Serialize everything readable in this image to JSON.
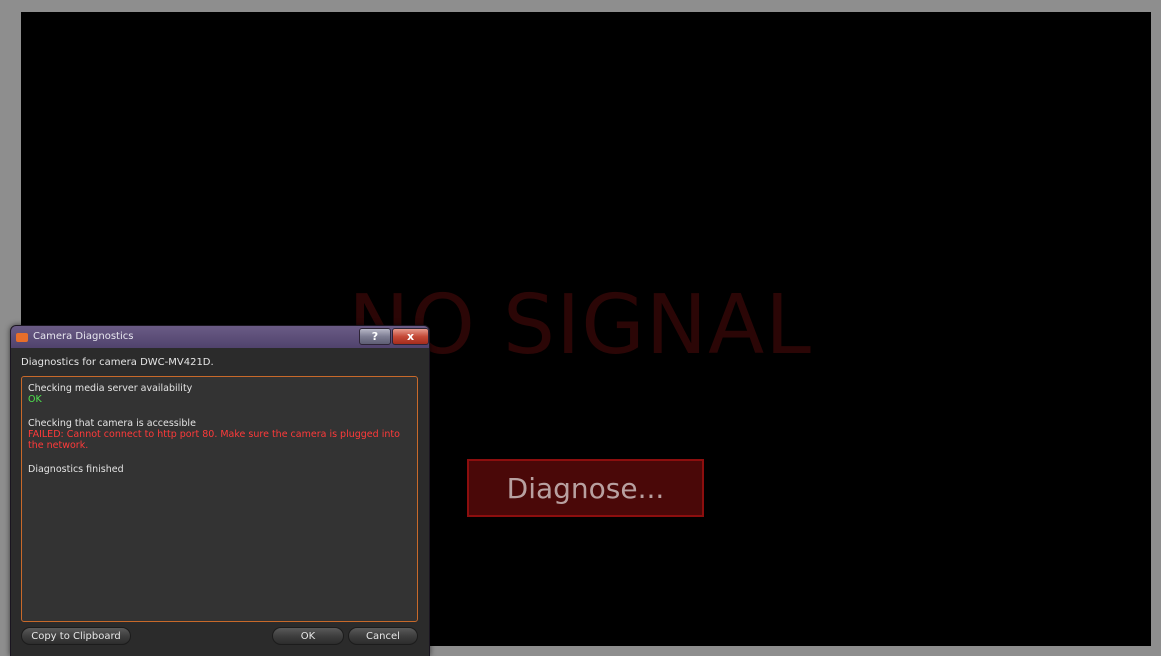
{
  "video": {
    "status_text": "NO SIGNAL",
    "diagnose_label": "Diagnose..."
  },
  "dialog": {
    "title": "Camera Diagnostics",
    "help_label": "?",
    "close_label": "x",
    "header": "Diagnostics for camera DWC-MV421D.",
    "log": {
      "step1": "Checking media server availability",
      "step1_result": "OK",
      "step2": "Checking that camera is accessible",
      "step2_result": "FAILED: Cannot connect to http port 80. Make sure the camera is plugged into the network.",
      "finished": "Diagnostics finished"
    },
    "buttons": {
      "copy": "Copy to Clipboard",
      "ok": "OK",
      "cancel": "Cancel"
    }
  },
  "colors": {
    "ok": "#4fe34f",
    "fail": "#ff3a3a",
    "accent_border": "#c8692a",
    "diagnose_border": "#8c0e0e"
  }
}
